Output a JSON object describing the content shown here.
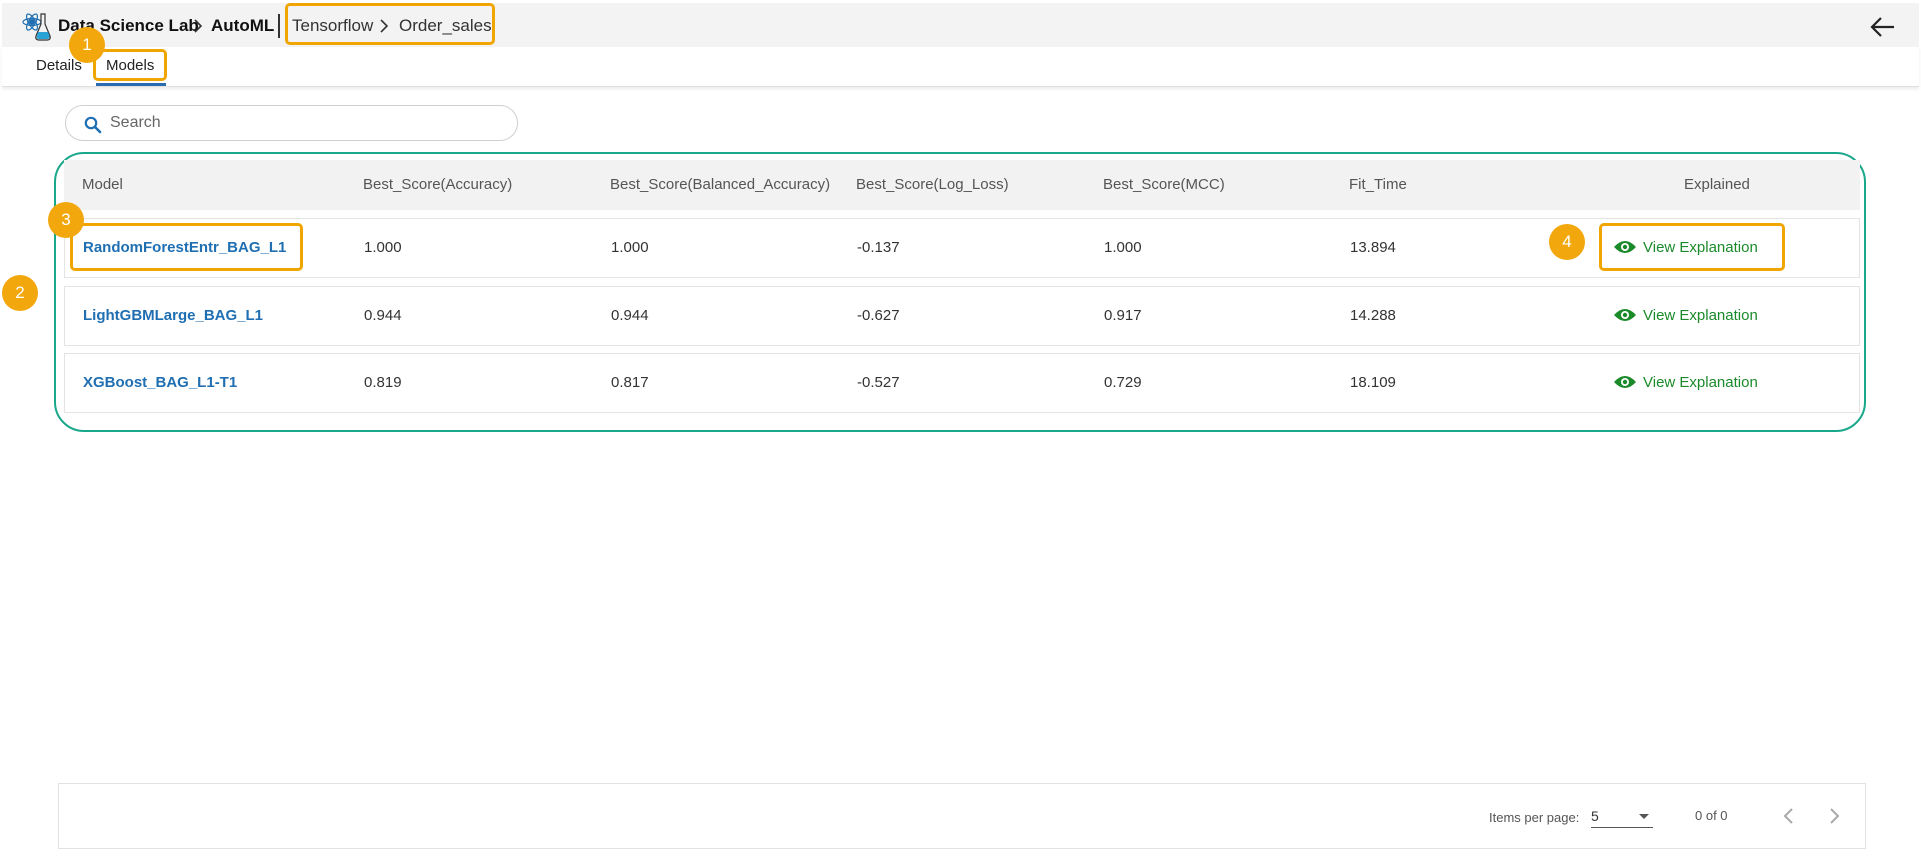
{
  "header": {
    "breadcrumb": [
      "Data Science Lab",
      "AutoML",
      "Tensorflow",
      "Order_sales"
    ]
  },
  "tabs": [
    {
      "label": "Details",
      "active": false
    },
    {
      "label": "Models",
      "active": true
    }
  ],
  "search": {
    "placeholder": "Search",
    "value": ""
  },
  "table": {
    "columns": [
      "Model",
      "Best_Score(Accuracy)",
      "Best_Score(Balanced_Accuracy)",
      "Best_Score(Log_Loss)",
      "Best_Score(MCC)",
      "Fit_Time",
      "Explained"
    ],
    "rows": [
      {
        "model": "RandomForestEntr_BAG_L1",
        "accuracy": "1.000",
        "balanced_accuracy": "1.000",
        "log_loss": "-0.137",
        "mcc": "1.000",
        "fit_time": "13.894",
        "explained": "View Explanation"
      },
      {
        "model": "LightGBMLarge_BAG_L1",
        "accuracy": "0.944",
        "balanced_accuracy": "0.944",
        "log_loss": "-0.627",
        "mcc": "0.917",
        "fit_time": "14.288",
        "explained": "View Explanation"
      },
      {
        "model": "XGBoost_BAG_L1-T1",
        "accuracy": "0.819",
        "balanced_accuracy": "0.817",
        "log_loss": "-0.527",
        "mcc": "0.729",
        "fit_time": "18.109",
        "explained": "View Explanation"
      }
    ]
  },
  "pagination": {
    "items_per_page_label": "Items per page:",
    "items_per_page": "5",
    "range": "0 of 0"
  },
  "annotations": [
    "1",
    "2",
    "3",
    "4"
  ],
  "colors": {
    "link": "#1f6fb2",
    "explain": "#1a8a2a",
    "annotation": "#f2a80c",
    "table_border": "#1aa88a",
    "tab_active": "#2b6cb0"
  },
  "icons": [
    "app-logo-icon",
    "chevron-right-icon",
    "back-arrow-icon",
    "search-icon",
    "eye-icon",
    "chevron-left-icon",
    "caret-down-icon"
  ]
}
